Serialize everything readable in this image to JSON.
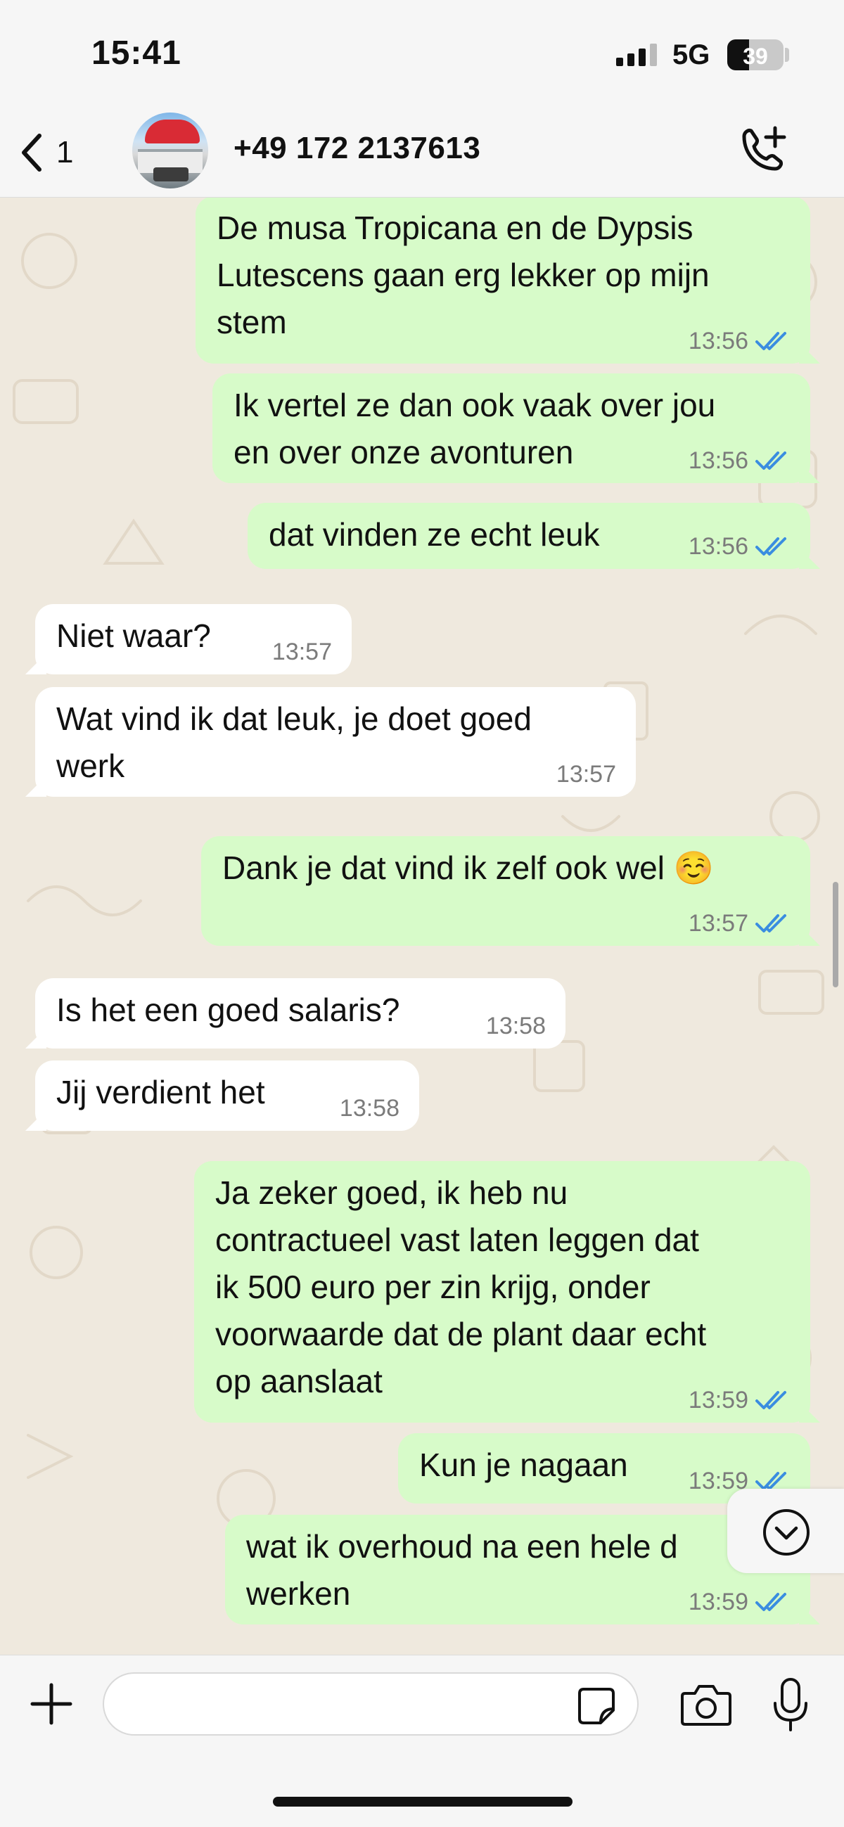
{
  "status_bar": {
    "time": "15:41",
    "network": "5G",
    "battery": "39",
    "battery_level": 0.39
  },
  "header": {
    "back_count": "1",
    "contact_name": "+49 172 2137613"
  },
  "messages": [
    {
      "dir": "out",
      "lines": [
        "De musa Tropicana en de Dypsis",
        "Lutescens gaan erg lekker op mijn",
        "stem"
      ],
      "time": "13:56",
      "read": true
    },
    {
      "dir": "out",
      "lines": [
        "Ik vertel ze dan ook vaak over jou",
        "en over onze avonturen"
      ],
      "time": "13:56",
      "read": true
    },
    {
      "dir": "out",
      "lines": [
        "dat vinden ze echt leuk"
      ],
      "time": "13:56",
      "read": true
    },
    {
      "dir": "in",
      "lines": [
        "Niet waar?"
      ],
      "time": "13:57"
    },
    {
      "dir": "in",
      "lines": [
        "Wat vind ik dat leuk, je doet goed",
        "werk"
      ],
      "time": "13:57"
    },
    {
      "dir": "out",
      "lines": [
        "Dank je dat vind ik zelf ook wel ☺️"
      ],
      "time": "13:57",
      "read": true
    },
    {
      "dir": "in",
      "lines": [
        "Is het een goed salaris?"
      ],
      "time": "13:58"
    },
    {
      "dir": "in",
      "lines": [
        "Jij verdient het"
      ],
      "time": "13:58"
    },
    {
      "dir": "out",
      "lines": [
        "Ja zeker goed, ik heb nu",
        "contractueel vast laten leggen dat",
        "ik 500 euro per zin krijg, onder",
        "voorwaarde dat de plant daar echt",
        "op aanslaat"
      ],
      "time": "13:59",
      "read": true
    },
    {
      "dir": "out",
      "lines": [
        "Kun je nagaan"
      ],
      "time": "13:59",
      "read": true
    },
    {
      "dir": "out",
      "lines": [
        "wat ik overhoud na een hele d",
        "werken"
      ],
      "time": "13:59",
      "read": true
    }
  ],
  "input": {
    "placeholder": ""
  },
  "colors": {
    "outgoing_bubble": "#d7fbc9",
    "incoming_bubble": "#ffffff",
    "read_ticks": "#3a8de0",
    "chat_background": "#efe9de"
  }
}
